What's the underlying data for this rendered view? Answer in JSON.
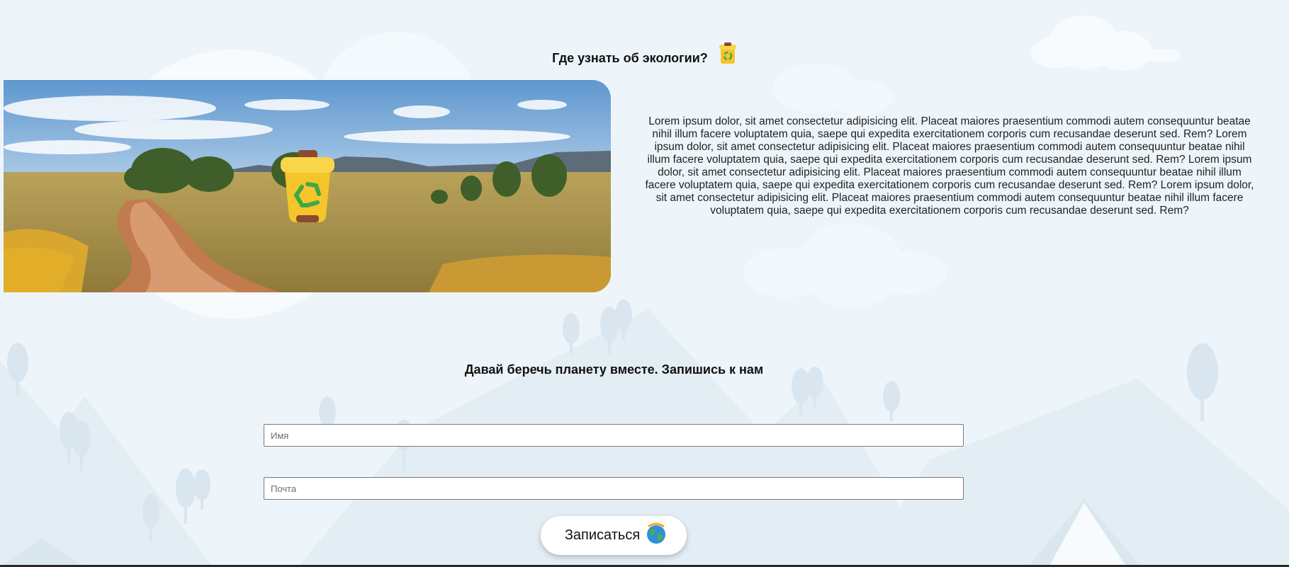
{
  "section_eco": {
    "title": "Где узнать об экологии?",
    "icon": "recycle-bin-icon",
    "image": "landscape-with-dirt-road",
    "text": "Lorem ipsum dolor, sit amet consectetur adipisicing elit. Placeat maiores praesentium commodi autem consequuntur beatae nihil illum facere voluptatem quia, saepe qui expedita exercitationem corporis cum recusandae deserunt sed. Rem? Lorem ipsum dolor, sit amet consectetur adipisicing elit. Placeat maiores praesentium commodi autem consequuntur beatae nihil illum facere voluptatem quia, saepe qui expedita exercitationem corporis cum recusandae deserunt sed. Rem? Lorem ipsum dolor, sit amet consectetur adipisicing elit. Placeat maiores praesentium commodi autem consequuntur beatae nihil illum facere voluptatem quia, saepe qui expedita exercitationem corporis cum recusandae deserunt sed. Rem? Lorem ipsum dolor, sit amet consectetur adipisicing elit. Placeat maiores praesentium commodi autem consequuntur beatae nihil illum facere voluptatem quia, saepe qui expedita exercitationem corporis cum recusandae deserunt sed. Rem?"
  },
  "signup": {
    "title": "Давай беречь планету вместе. Запишись к нам",
    "name_placeholder": "Имя",
    "name_value": "",
    "email_placeholder": "Почта",
    "email_value": "",
    "button_label": "Записаться",
    "button_icon": "globe-icon"
  },
  "colors": {
    "background": "#eef5fa",
    "sky": "#6fa3d4",
    "grass": "#c8a95a",
    "bin_yellow": "#f7c934",
    "recycle_green": "#46b04a"
  }
}
